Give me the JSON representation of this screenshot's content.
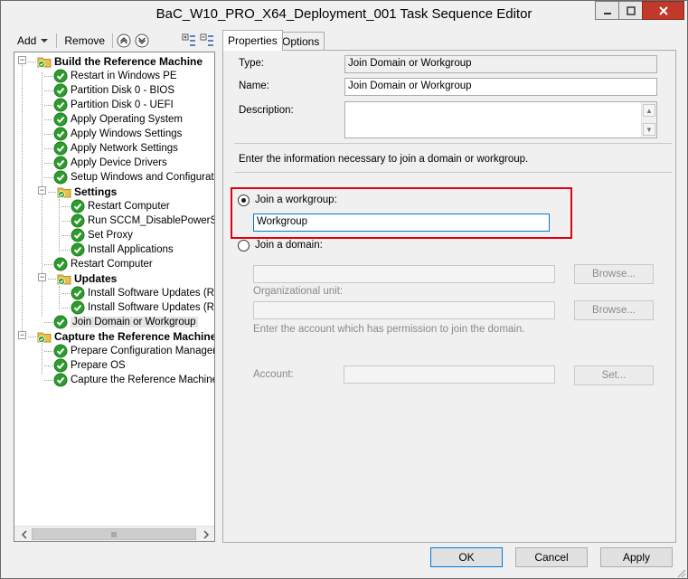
{
  "window": {
    "title": "BaC_W10_PRO_X64_Deployment_001 Task Sequence Editor"
  },
  "toolbar": {
    "add_label": "Add",
    "remove_label": "Remove"
  },
  "tree": {
    "items": [
      {
        "label": "Build the Reference Machine",
        "type": "group"
      },
      {
        "label": "Restart in Windows PE",
        "type": "step"
      },
      {
        "label": "Partition Disk 0 - BIOS",
        "type": "step"
      },
      {
        "label": "Partition Disk 0 - UEFI",
        "type": "step"
      },
      {
        "label": "Apply Operating System",
        "type": "step"
      },
      {
        "label": "Apply Windows Settings",
        "type": "step"
      },
      {
        "label": "Apply Network Settings",
        "type": "step"
      },
      {
        "label": "Apply Device Drivers",
        "type": "step"
      },
      {
        "label": "Setup Windows and Configuration",
        "type": "step"
      },
      {
        "label": "Settings",
        "type": "group"
      },
      {
        "label": "Restart Computer",
        "type": "step"
      },
      {
        "label": "Run SCCM_DisablePowerSav",
        "type": "step"
      },
      {
        "label": "Set Proxy",
        "type": "step"
      },
      {
        "label": "Install Applications",
        "type": "step"
      },
      {
        "label": "Restart Computer",
        "type": "step"
      },
      {
        "label": "Updates",
        "type": "group"
      },
      {
        "label": "Install Software Updates (Rec",
        "type": "step"
      },
      {
        "label": "Install Software Updates (Rec",
        "type": "step"
      },
      {
        "label": "Join Domain or Workgroup",
        "type": "step"
      },
      {
        "label": "Capture the Reference Machine",
        "type": "group"
      },
      {
        "label": "Prepare Configuration Manager Cl",
        "type": "step"
      },
      {
        "label": "Prepare OS",
        "type": "step"
      },
      {
        "label": "Capture the Reference Machine",
        "type": "step"
      }
    ]
  },
  "tabs": {
    "properties": "Properties",
    "options": "Options"
  },
  "properties": {
    "type_label": "Type:",
    "type_value": "Join Domain or Workgroup",
    "name_label": "Name:",
    "name_value": "Join Domain or Workgroup",
    "description_label": "Description:",
    "description_value": "",
    "instructions": "Enter the information necessary to join a domain or workgroup.",
    "join_workgroup_label": "Join a workgroup:",
    "workgroup_value": "Workgroup",
    "join_domain_label": "Join a domain:",
    "domain_value": "",
    "browse_label": "Browse...",
    "ou_label": "Organizational unit:",
    "ou_value": "",
    "browse_ou_label": "Browse...",
    "account_hint": "Enter the account which has permission to join the domain.",
    "account_label": "Account:",
    "account_value": "",
    "set_label": "Set..."
  },
  "footer": {
    "ok_label": "OK",
    "cancel_label": "Cancel",
    "apply_label": "Apply"
  },
  "colors": {
    "highlight": "#e1000f",
    "check_green": "#2e9b2e",
    "folder_yellow": "#e9c04a"
  }
}
